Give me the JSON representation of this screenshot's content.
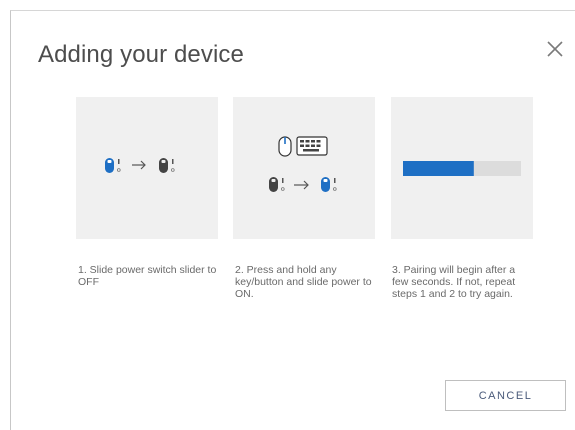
{
  "dialog": {
    "title": "Adding your device",
    "close_icon": "close-icon",
    "cancel_label": "CANCEL"
  },
  "steps": [
    {
      "text": "1. Slide power switch slider to OFF",
      "illustration": "mouse-off-to-on-icon"
    },
    {
      "text": "2. Press and hold any key/button and slide power to ON.",
      "illustration": "mouse-keyboard-power-icon"
    },
    {
      "text": "3. Pairing will begin after a few seconds. If not, repeat steps 1 and 2 to try again.",
      "illustration": "pairing-progress-bar"
    }
  ],
  "pairing": {
    "progress": 0.6
  },
  "colors": {
    "accent": "#1e6fc4",
    "panel": "#f0f0f0",
    "track": "#dcdcdc"
  }
}
